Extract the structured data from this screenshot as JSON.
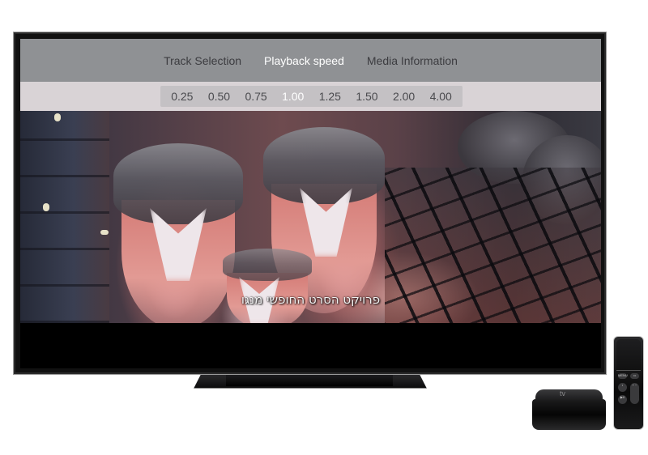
{
  "menu": {
    "tabs": [
      {
        "label": "Track Selection",
        "selected": false
      },
      {
        "label": "Playback speed",
        "selected": true
      },
      {
        "label": "Media Information",
        "selected": false
      }
    ]
  },
  "playback_speed": {
    "options": [
      "0.25",
      "0.50",
      "0.75",
      "1.00",
      "1.25",
      "1.50",
      "2.00",
      "4.00"
    ],
    "selected": "1.00"
  },
  "video": {
    "subtitle": "פרויקט הסרט החופשי מנגו"
  },
  "device": {
    "logo_text": " tv",
    "remote_buttons": {
      "menu": "MENU",
      "home": "▭",
      "siri": "•",
      "play_pause": "▶II",
      "volume": "+ −"
    }
  },
  "colors": {
    "menu_bar_bg": "#8f9194",
    "speed_strip_bg": "#d9d3d6",
    "selected_text": "#ffffff",
    "unselected_text": "#3c3c40"
  }
}
